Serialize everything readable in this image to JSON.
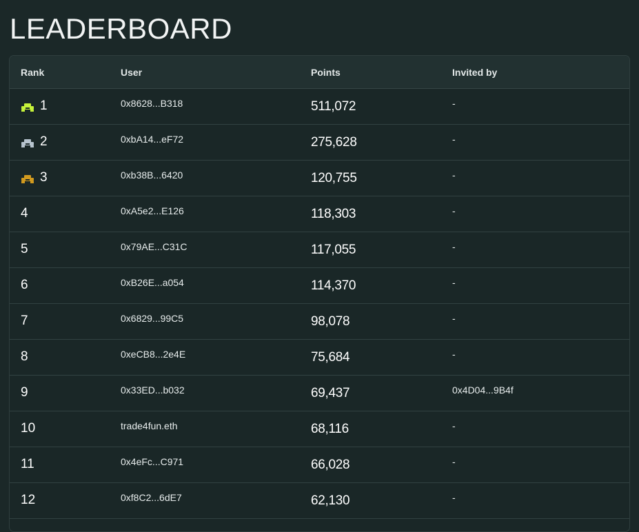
{
  "title": "LEADERBOARD",
  "columns": {
    "rank": "Rank",
    "user": "User",
    "points": "Points",
    "invited_by": "Invited by"
  },
  "medal_colors": [
    "#c6f23a",
    "#b7c4ce",
    "#d19a1f"
  ],
  "rows": [
    {
      "rank": "1",
      "user": "0x8628...B318",
      "points": "511,072",
      "invited_by": "-",
      "icon": "gold-trophy-icon"
    },
    {
      "rank": "2",
      "user": "0xbA14...eF72",
      "points": "275,628",
      "invited_by": "-",
      "icon": "silver-trophy-icon"
    },
    {
      "rank": "3",
      "user": "0xb38B...6420",
      "points": "120,755",
      "invited_by": "-",
      "icon": "bronze-trophy-icon"
    },
    {
      "rank": "4",
      "user": "0xA5e2...E126",
      "points": "118,303",
      "invited_by": "-"
    },
    {
      "rank": "5",
      "user": "0x79AE...C31C",
      "points": "117,055",
      "invited_by": "-"
    },
    {
      "rank": "6",
      "user": "0xB26E...a054",
      "points": "114,370",
      "invited_by": "-"
    },
    {
      "rank": "7",
      "user": "0x6829...99C5",
      "points": "98,078",
      "invited_by": "-"
    },
    {
      "rank": "8",
      "user": "0xeCB8...2e4E",
      "points": "75,684",
      "invited_by": "-"
    },
    {
      "rank": "9",
      "user": "0x33ED...b032",
      "points": "69,437",
      "invited_by": "0x4D04...9B4f"
    },
    {
      "rank": "10",
      "user": "trade4fun.eth",
      "points": "68,116",
      "invited_by": "-"
    },
    {
      "rank": "11",
      "user": "0x4eFc...C971",
      "points": "66,028",
      "invited_by": "-"
    },
    {
      "rank": "12",
      "user": "0xf8C2...6dE7",
      "points": "62,130",
      "invited_by": "-"
    }
  ]
}
